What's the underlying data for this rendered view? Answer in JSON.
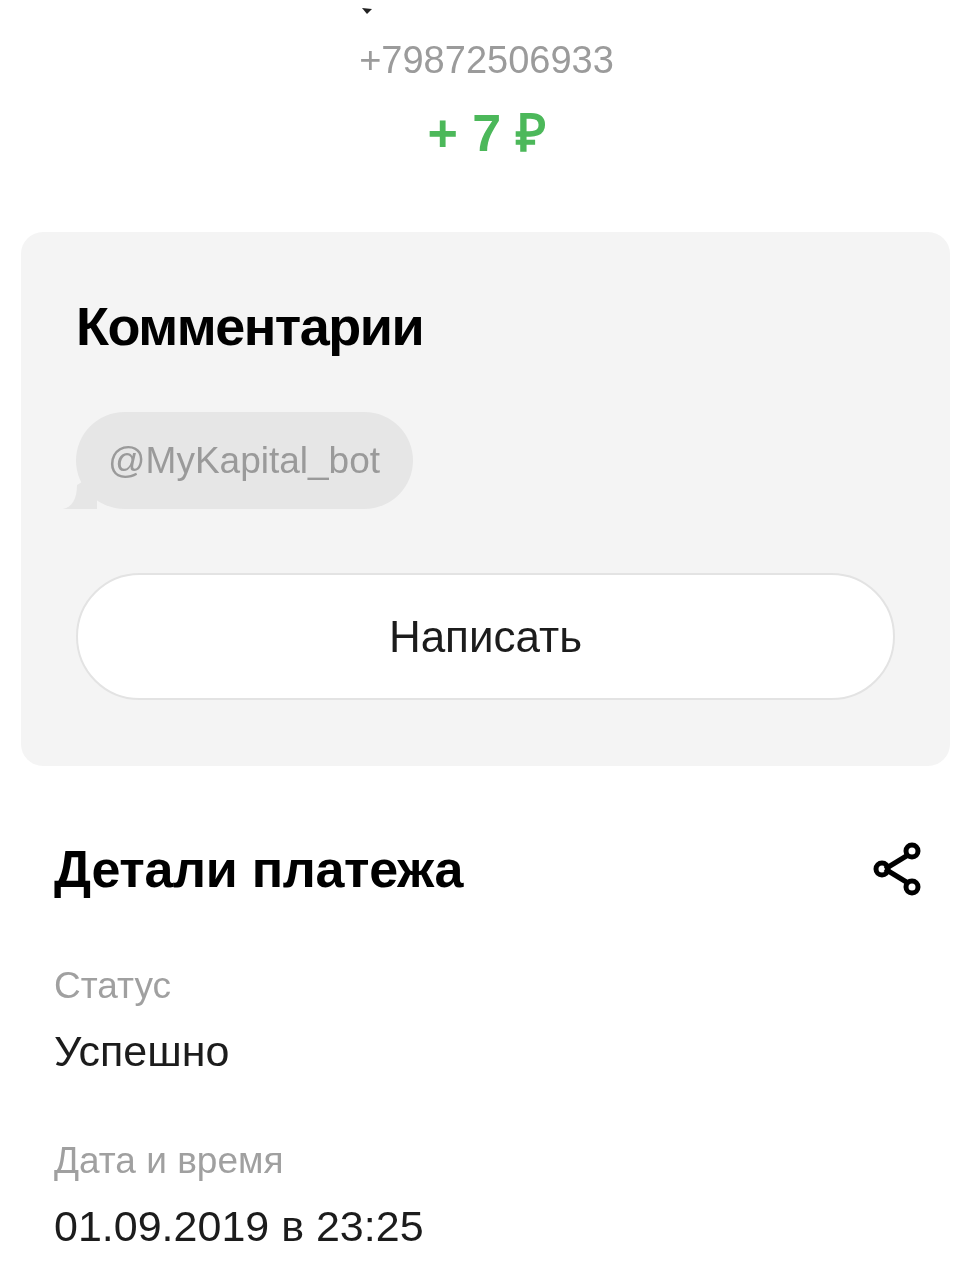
{
  "header": {
    "phone": "+79872506933",
    "amount": "+ 7 ₽"
  },
  "comments": {
    "title": "Комментарии",
    "messages": [
      {
        "text": "@MyKapital_bot"
      }
    ],
    "write_button": "Написать"
  },
  "details": {
    "title": "Детали платежа",
    "fields": [
      {
        "label": "Статус",
        "value": "Успешно"
      },
      {
        "label": "Дата и время",
        "value": "01.09.2019 в 23:25"
      }
    ]
  }
}
